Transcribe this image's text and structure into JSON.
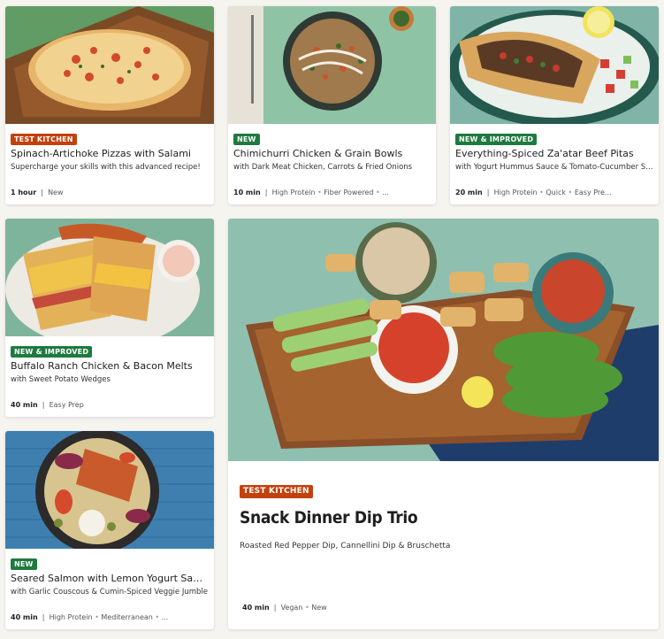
{
  "recipes": [
    {
      "badge": "TEST KITCHEN",
      "badge_color": "#c2410c",
      "title": "Spinach-Artichoke Pizzas with Salami",
      "subtitle": "Supercharge your skills with this advanced recipe!",
      "time": "1 hour",
      "tags": [
        "New"
      ]
    },
    {
      "badge": "NEW",
      "badge_color": "#1f7a3f",
      "title": "Chimichurri Chicken & Grain Bowls",
      "subtitle": "with Dark Meat Chicken, Carrots & Fried Onions",
      "time": "10 min",
      "tags": [
        "High Protein",
        "Fiber Powered",
        "..."
      ]
    },
    {
      "badge": "NEW & IMPROVED",
      "badge_color": "#1f7a3f",
      "title": "Everything-Spiced Za'atar Beef Pitas",
      "subtitle": "with Yogurt Hummus Sauce & Tomato-Cucumber Sal...",
      "time": "20 min",
      "tags": [
        "High Protein",
        "Quick",
        "Easy Pre..."
      ]
    },
    {
      "badge": "NEW & IMPROVED",
      "badge_color": "#1f7a3f",
      "title": "Buffalo Ranch Chicken & Bacon Melts",
      "subtitle": "with Sweet Potato Wedges",
      "time": "40 min",
      "tags": [
        "Easy Prep"
      ]
    },
    {
      "badge": "TEST KITCHEN",
      "badge_color": "#c2410c",
      "title": "Snack Dinner Dip Trio",
      "subtitle": "Roasted Red Pepper Dip, Cannellini Dip & Bruschetta",
      "time": "40 min",
      "tags": [
        "Vegan",
        "New"
      ]
    },
    {
      "badge": "NEW",
      "badge_color": "#1f7a3f",
      "title": "Seared Salmon with Lemon Yogurt Sauce",
      "subtitle": "with Garlic Couscous & Cumin-Spiced Veggie Jumble",
      "time": "40 min",
      "tags": [
        "High Protein",
        "Mediterranean",
        "..."
      ]
    }
  ]
}
